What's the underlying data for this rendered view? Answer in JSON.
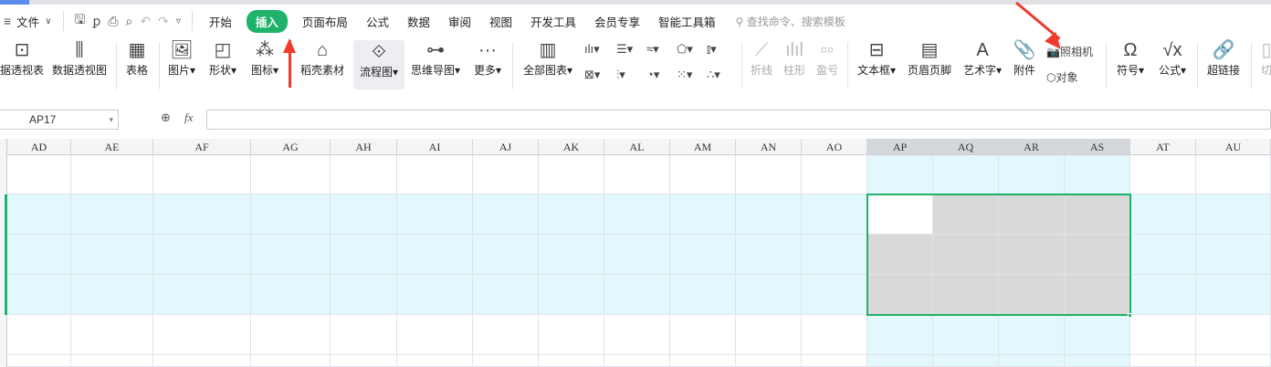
{
  "menu": {
    "file": "文件",
    "tabs": [
      "开始",
      "插入",
      "页面布局",
      "公式",
      "数据",
      "审阅",
      "视图",
      "开发工具",
      "会员专享",
      "智能工具箱"
    ],
    "active_tab": "插入",
    "search_placeholder": "查找命令、搜索模板"
  },
  "ribbon": {
    "pivot_table": "据透视表",
    "pivot_chart": "数据透视图",
    "table": "表格",
    "picture": "图片",
    "shape": "形状",
    "icon": "图标",
    "daoke": "稻壳素材",
    "flowchart": "流程图",
    "mindmap": "思维导图",
    "more": "更多",
    "all_charts": "全部图表",
    "sparkline_line": "折线",
    "sparkline_col": "柱形",
    "sparkline_wl": "盈亏",
    "textbox": "文本框",
    "header_footer": "页眉页脚",
    "wordart": "艺术字",
    "attachment": "附件",
    "camera": "照相机",
    "object": "对象",
    "symbol": "符号",
    "formula": "公式",
    "hyperlink": "超链接",
    "slicer": "切"
  },
  "formula_bar": {
    "name_box": "AP17",
    "fx": "fx",
    "value": ""
  },
  "columns": [
    "AD",
    "AE",
    "AF",
    "AG",
    "AH",
    "AI",
    "AJ",
    "AK",
    "AL",
    "AM",
    "AN",
    "AO",
    "AP",
    "AQ",
    "AR",
    "AS",
    "AT",
    "AU"
  ],
  "selected_columns": [
    "AP",
    "AQ",
    "AR",
    "AS"
  ],
  "colors": {
    "accent": "#1fb26b",
    "highlight": "#e3f8fc",
    "selection_fill": "#d9d9d9",
    "annotation_arrow": "#f03a2e"
  }
}
